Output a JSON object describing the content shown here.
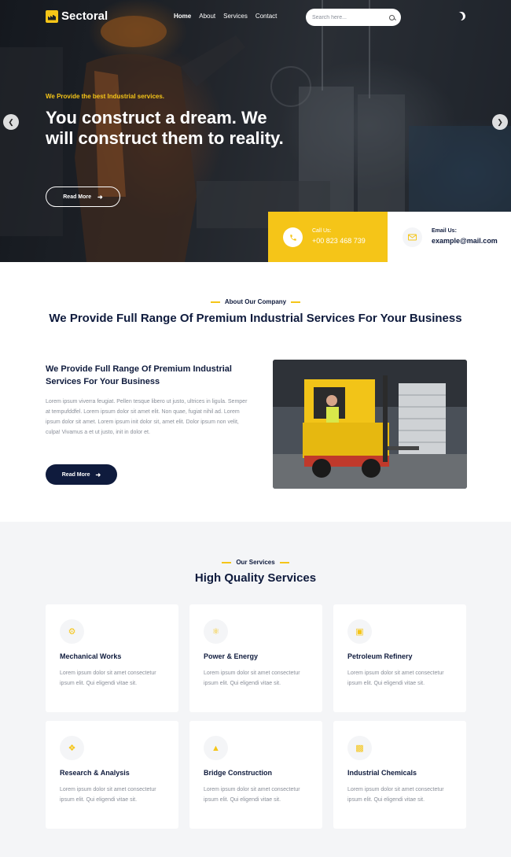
{
  "brand": {
    "name": "Sectoral",
    "accent": "#f5c518",
    "navy": "#0f1b3d"
  },
  "nav": {
    "items": [
      "Home",
      "About",
      "Services",
      "Contact"
    ]
  },
  "search": {
    "placeholder": "Search here..."
  },
  "hero": {
    "tagline": "We Provide the best Industrial services.",
    "title": "You construct a dream. We will construct them to reality.",
    "button": "Read More"
  },
  "contact": {
    "call_label": "Call Us:",
    "call_value": "+00 823 468 739",
    "email_label": "Email Us:",
    "email_value": "example@mail.com"
  },
  "about": {
    "tag": "About Our Company",
    "title": "We Provide Full Range Of Premium Industrial Services For Your Business",
    "subtitle": "We Provide Full Range Of Premium Industrial Services For Your Business",
    "body": "Lorem ipsum viverra feugiat. Pellen tesque libero ut justo, ultrices in ligula. Semper at tempufddfel. Lorem ipsum dolor sit amet elit. Non quae, fugiat nihil ad. Lorem ipsum dolor sit amet. Lorem ipsum init dolor sit, amet elit. Dolor ipsum non velit, culpa! Vivamus a et ut justo, init in dolor et.",
    "button": "Read More"
  },
  "services": {
    "tag": "Our Services",
    "title": "High Quality Services",
    "items": [
      {
        "title": "Mechanical Works",
        "text": "Lorem ipsum dolor sit amet consectetur ipsum elit. Qui eligendi vitae sit.",
        "icon": "gears-icon"
      },
      {
        "title": "Power & Energy",
        "text": "Lorem ipsum dolor sit amet consectetur ipsum elit. Qui eligendi vitae sit.",
        "icon": "energy-icon"
      },
      {
        "title": "Petroleum Refinery",
        "text": "Lorem ipsum dolor sit amet consectetur ipsum elit. Qui eligendi vitae sit.",
        "icon": "refinery-icon"
      },
      {
        "title": "Research & Analysis",
        "text": "Lorem ipsum dolor sit amet consectetur ipsum elit. Qui eligendi vitae sit.",
        "icon": "research-icon"
      },
      {
        "title": "Bridge Construction",
        "text": "Lorem ipsum dolor sit amet consectetur ipsum elit. Qui eligendi vitae sit.",
        "icon": "network-icon"
      },
      {
        "title": "Industrial Chemicals",
        "text": "Lorem ipsum dolor sit amet consectetur ipsum elit. Qui eligendi vitae sit.",
        "icon": "factory-icon"
      }
    ]
  }
}
